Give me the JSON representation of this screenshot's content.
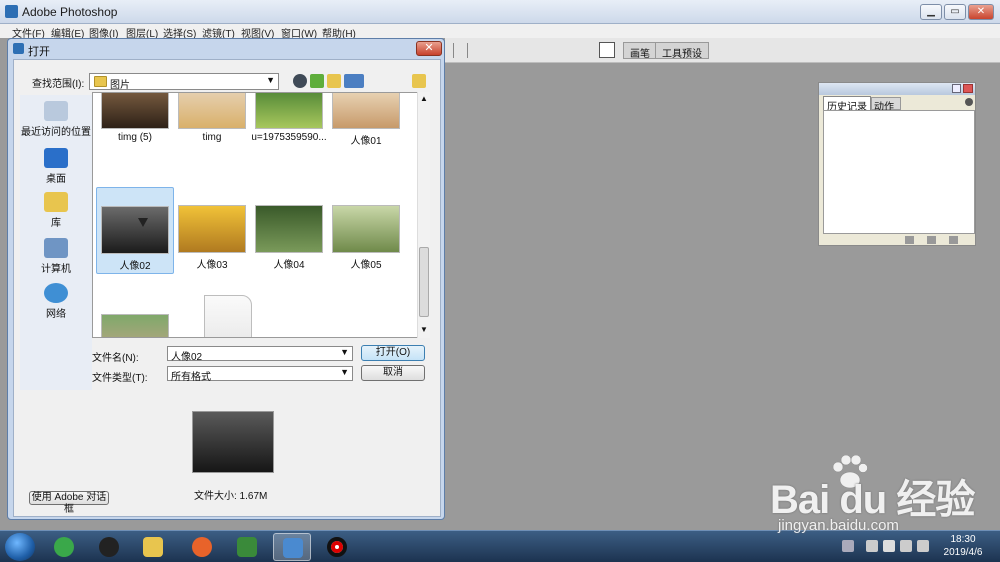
{
  "app": {
    "title": "Adobe Photoshop"
  },
  "window_controls": {
    "minimize": "▁",
    "maximize": "▭",
    "close": "✕"
  },
  "menu": [
    "文件(F)",
    "编辑(E)",
    "图像(I)",
    "图层(L)",
    "选择(S)",
    "滤镜(T)",
    "视图(V)",
    "窗口(W)",
    "帮助(H)"
  ],
  "workspace_tabs": [
    "画笔",
    "工具预设"
  ],
  "history_panel": {
    "tabs": [
      "历史记录",
      "动作"
    ]
  },
  "dialog": {
    "title": "打开",
    "close": "✕",
    "look_in_label": "查找范围(I):",
    "look_in_value": "图片",
    "places": [
      "最近访问的位置",
      "桌面",
      "库",
      "计算机",
      "网络"
    ],
    "files": [
      {
        "name": "timg (5)",
        "kind": "image"
      },
      {
        "name": "timg",
        "kind": "image"
      },
      {
        "name": "u=1975359590...",
        "kind": "image"
      },
      {
        "name": "人像01",
        "kind": "image"
      },
      {
        "name": "人像02",
        "kind": "image",
        "selected": true
      },
      {
        "name": "人像03",
        "kind": "image"
      },
      {
        "name": "人像04",
        "kind": "image"
      },
      {
        "name": "人像05",
        "kind": "image"
      },
      {
        "name": "",
        "kind": "image"
      },
      {
        "name": "",
        "kind": "document"
      }
    ],
    "filename_label": "文件名(N):",
    "filename_value": "人像02",
    "filetype_label": "文件类型(T):",
    "filetype_value": "所有格式",
    "open_button": "打开(O)",
    "cancel_button": "取消",
    "file_size": "文件大小: 1.67M",
    "adobe_dialog_button": "使用 Adobe 对话框"
  },
  "taskbar": {
    "time": "18:30",
    "date": "2019/4/6"
  },
  "watermark": {
    "brand": "Bai du 经验",
    "url": "jingyan.baidu.com"
  }
}
